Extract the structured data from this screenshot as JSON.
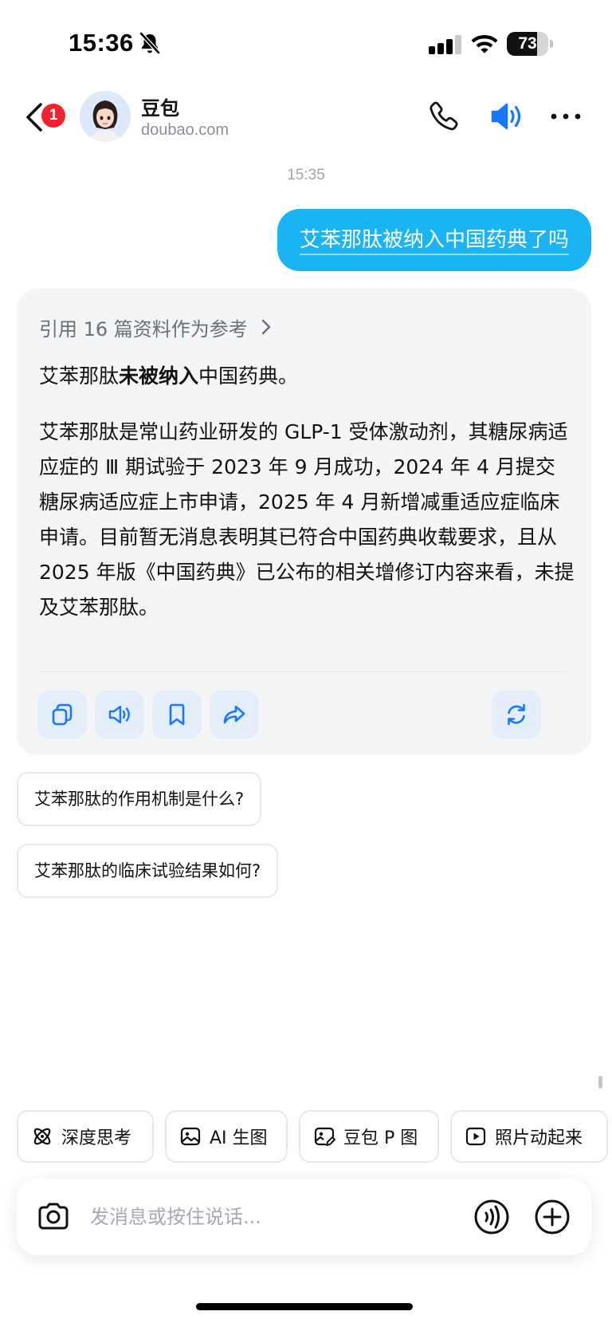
{
  "status_bar": {
    "time": "15:36",
    "battery_percent": "73",
    "battery_level": 0.73,
    "icons": [
      "bell-muted-icon",
      "cellular-signal-icon",
      "wifi-icon",
      "battery-icon"
    ]
  },
  "header": {
    "back_icon": "chevron-left-icon",
    "unread_count": "1",
    "bot_name": "豆包",
    "bot_domain": "doubao.com",
    "actions": [
      "phone-icon",
      "speaker-icon",
      "more-icon"
    ],
    "accent_color": "#1677ff"
  },
  "chat": {
    "timestamp": "15:35",
    "user_message": "艾苯那肽被纳入中国药典了吗",
    "user_bubble_color": "#1ab4f5",
    "reply": {
      "citation": "引用 16 篇资料作为参考",
      "lead_before": "艾苯那肽",
      "lead_bold": "未被纳入",
      "lead_after": "中国药典。",
      "body": "艾苯那肽是常山药业研发的 GLP-1 受体激动剂，其糖尿病适应症的 Ⅲ 期试验于 2023 年 9 月成功，2024 年 4 月提交糖尿病适应症上市申请，2025 年 4 月新增减重适应症临床申请。目前暂无消息表明其已符合中国药典收载要求，且从 2025 年版《中国药典》已公布的相关增修订内容来看，未提及艾苯那肽。",
      "actions": [
        "copy-icon",
        "read-aloud-icon",
        "bookmark-icon",
        "share-icon",
        "regenerate-icon"
      ]
    },
    "suggestions": [
      "艾苯那肽的作用机制是什么?",
      "艾苯那肽的临床试验结果如何?"
    ]
  },
  "quick_actions": [
    {
      "label": "深度思考",
      "icon": "atom-icon"
    },
    {
      "label": "AI 生图",
      "icon": "image-icon"
    },
    {
      "label": "豆包 P 图",
      "icon": "image-edit-icon"
    },
    {
      "label": "照片动起来",
      "icon": "play-icon"
    }
  ],
  "input": {
    "placeholder": "发消息或按住说话...",
    "icons": [
      "camera-icon",
      "voice-icon",
      "plus-icon"
    ]
  }
}
